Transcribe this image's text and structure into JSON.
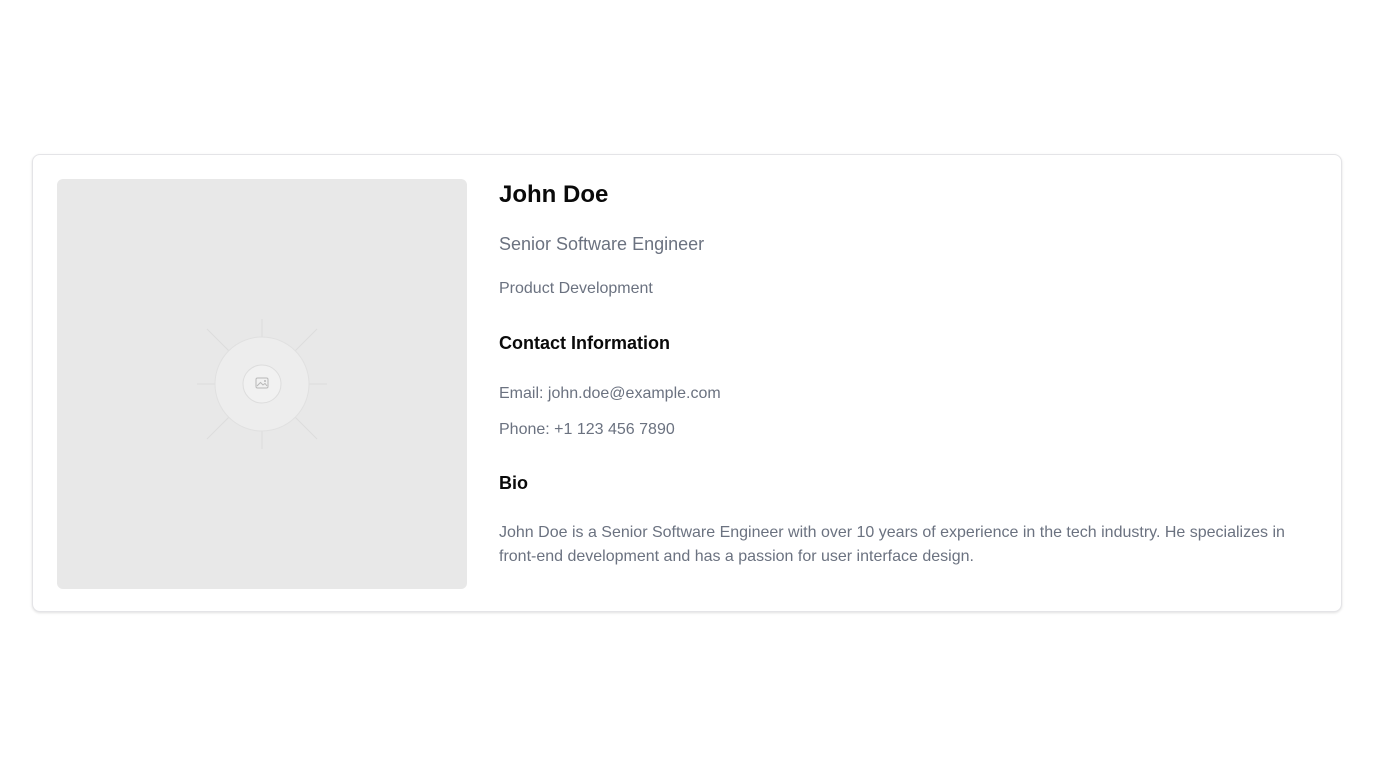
{
  "profile": {
    "name": "John Doe",
    "title": "Senior Software Engineer",
    "department": "Product Development",
    "photo_icon": "image-placeholder-icon"
  },
  "contact": {
    "heading": "Contact Information",
    "email_label": "Email:",
    "email": "john.doe@example.com",
    "phone_label": "Phone:",
    "phone": "+1 123 456 7890"
  },
  "bio": {
    "heading": "Bio",
    "text": "John Doe is a Senior Software Engineer with over 10 years of experience in the tech industry. He specializes in front-end development and has a passion for user interface design."
  },
  "colors": {
    "background": "#ffffff",
    "card_border": "#e4e4e7",
    "photo_placeholder": "#e8e8e8",
    "heading_text": "#0a0a0a",
    "muted_text": "#6b7280"
  }
}
